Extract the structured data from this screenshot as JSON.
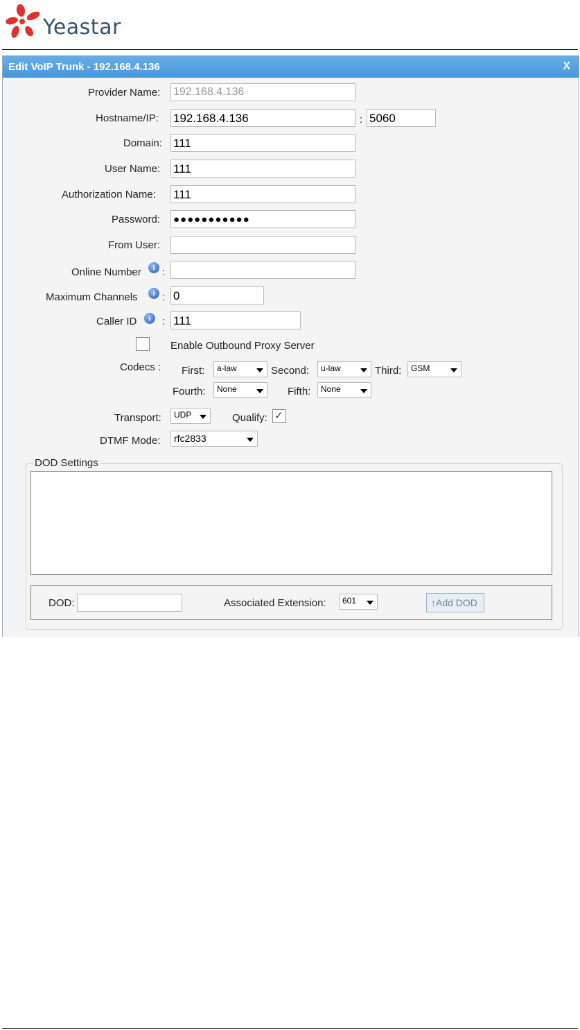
{
  "brand": {
    "name": "Yeastar"
  },
  "dialog": {
    "title": "Edit VoIP Trunk - 192.168.4.136",
    "close_label": "X"
  },
  "form": {
    "provider_name": {
      "label": "Provider Name:",
      "value": "192.168.4.136"
    },
    "hostname": {
      "label": "Hostname/IP:",
      "value": "192.168.4.136",
      "separator": ":",
      "port": "5060"
    },
    "domain": {
      "label": "Domain:",
      "value": "111"
    },
    "user_name": {
      "label": "User Name:",
      "value": "111"
    },
    "auth_name": {
      "label": "Authorization Name:",
      "value": "111"
    },
    "password": {
      "label": "Password:",
      "value": "●●●●●●●●●●●"
    },
    "from_user": {
      "label": "From User:",
      "value": ""
    },
    "online_number": {
      "label": "Online Number",
      "colon": ":",
      "value": ""
    },
    "max_channels": {
      "label": "Maximum Channels",
      "colon": ":",
      "value": "0"
    },
    "caller_id": {
      "label": "Caller ID",
      "colon": ":",
      "value": "111"
    },
    "outbound_proxy": {
      "label": "Enable Outbound Proxy Server",
      "checked": false
    },
    "codecs": {
      "label": "Codecs :",
      "first_label": "First:",
      "first": "a-law",
      "second_label": "Second:",
      "second": "u-law",
      "third_label": "Third:",
      "third": "GSM",
      "fourth_label": "Fourth:",
      "fourth": "None",
      "fifth_label": "Fifth:",
      "fifth": "None"
    },
    "transport": {
      "label": "Transport:",
      "value": "UDP"
    },
    "qualify": {
      "label": "Qualify:",
      "checked": true
    },
    "dtmf": {
      "label": "DTMF Mode:",
      "value": "rfc2833"
    }
  },
  "dod": {
    "legend": "DOD Settings",
    "dod_label": "DOD:",
    "dod_value": "",
    "ext_label": "Associated Extension:",
    "ext_value": "601",
    "add_button": "↑Add DOD"
  },
  "icons": {
    "info": "info-icon",
    "dropdown": "chevron-down-icon",
    "logo": "yeastar-logo"
  }
}
